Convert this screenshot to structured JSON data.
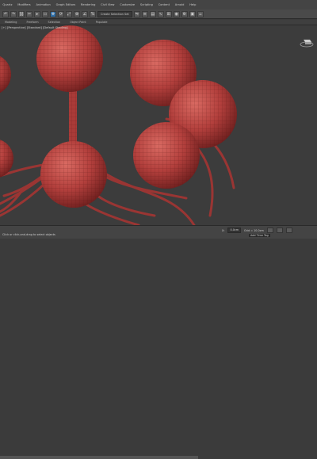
{
  "menu": [
    "Quartz",
    "Modifiers",
    "Animation",
    "Graph Editors",
    "Rendering",
    "Civil View",
    "Customize",
    "Scripting",
    "Content",
    "Arnold",
    "Help"
  ],
  "toolbar": {
    "selection_set_placeholder": "Create Selection Set"
  },
  "ribbon": [
    "Modeling",
    "Freeform",
    "Selection",
    "Object Paint",
    "Populate"
  ],
  "viewport": {
    "label": "[+] [Perspective] [Standard] [Default Shading]"
  },
  "status": {
    "left": "Click or click-and-drag to select objects",
    "x_label": "X:",
    "x_value": "0.0cm",
    "grid_label": "Grid = 10.0cm",
    "add_time_tag": "Add Time Tag"
  },
  "colors": {
    "sphere": "#b5403f",
    "viewport_bg": "#3c3c3c",
    "accent": "#2f6fa8"
  }
}
